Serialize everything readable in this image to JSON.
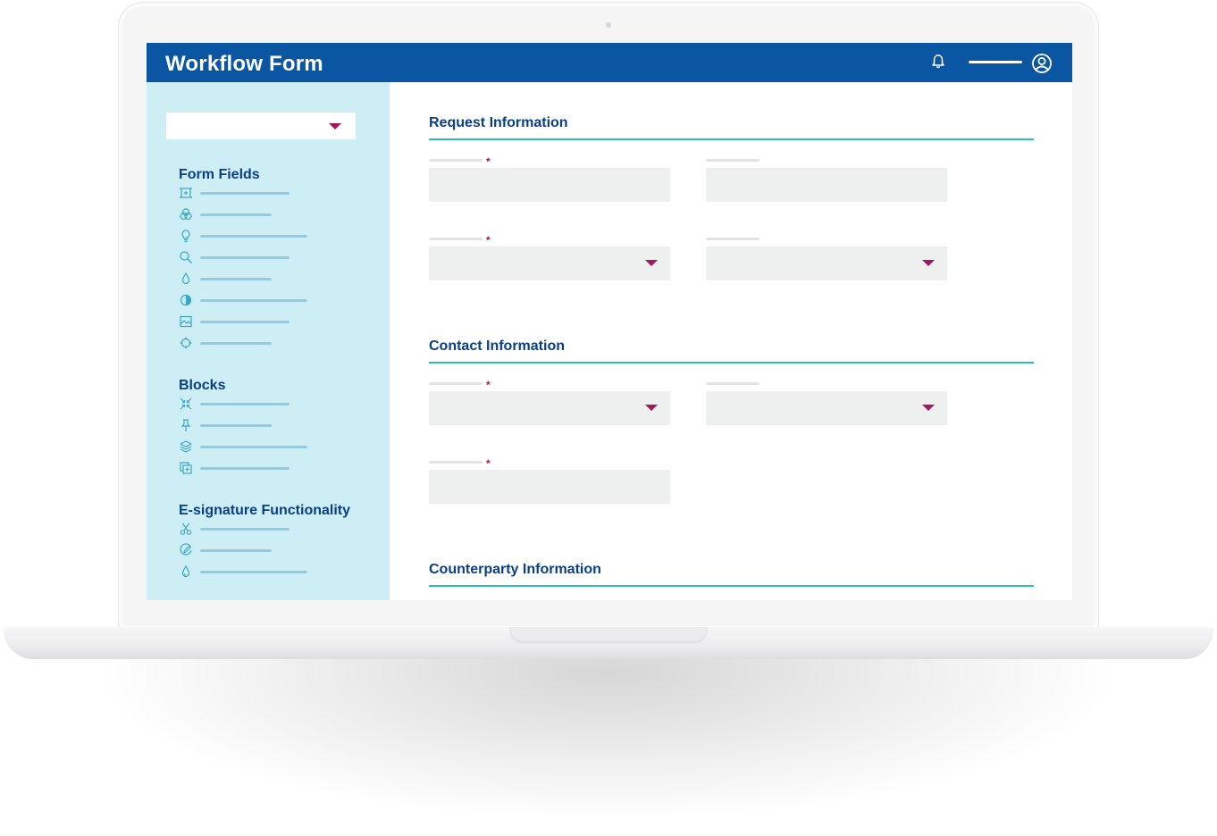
{
  "app": {
    "title": "Workflow Form",
    "brand_color": "#0a56a3",
    "accent_color": "#2ebccc",
    "required_color": "#a3195b",
    "sidebar_bg": "#cdeef5"
  },
  "header": {
    "icons": [
      "bell-icon",
      "menu-bar",
      "user-icon"
    ]
  },
  "sidebar": {
    "dropdown": {
      "value": "",
      "icon": "chevron-down-icon"
    },
    "sections": [
      {
        "title": "Form Fields",
        "items": [
          {
            "icon": "crop-icon"
          },
          {
            "icon": "circles-icon"
          },
          {
            "icon": "lightbulb-icon"
          },
          {
            "icon": "search-icon"
          },
          {
            "icon": "droplet-icon"
          },
          {
            "icon": "contrast-icon"
          },
          {
            "icon": "image-icon"
          },
          {
            "icon": "crosshair-icon"
          }
        ]
      },
      {
        "title": "Blocks",
        "items": [
          {
            "icon": "shrink-icon"
          },
          {
            "icon": "pin-icon"
          },
          {
            "icon": "layers-icon"
          },
          {
            "icon": "copy-icon"
          }
        ]
      },
      {
        "title": "E-signature Functionality",
        "items": [
          {
            "icon": "scissors-icon"
          },
          {
            "icon": "pen-icon"
          },
          {
            "icon": "droplet-icon"
          }
        ]
      }
    ]
  },
  "form": {
    "sections": [
      {
        "title": "Request Information",
        "fields": [
          {
            "type": "text",
            "required": true
          },
          {
            "type": "text",
            "required": false
          },
          {
            "type": "select",
            "required": true
          },
          {
            "type": "select",
            "required": false
          }
        ]
      },
      {
        "title": "Contact Information",
        "fields": [
          {
            "type": "select",
            "required": true
          },
          {
            "type": "select",
            "required": false
          },
          {
            "type": "text",
            "required": true
          }
        ]
      },
      {
        "title": "Counterparty Information",
        "fields": []
      }
    ],
    "required_marker": "*"
  }
}
